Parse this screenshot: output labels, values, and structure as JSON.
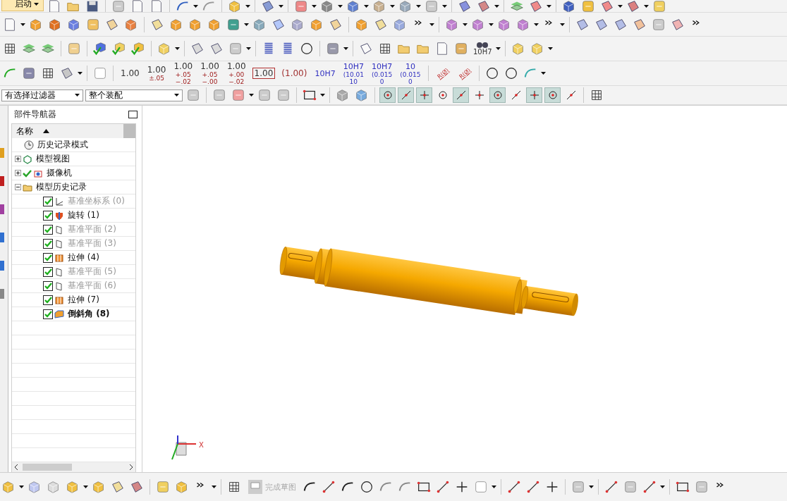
{
  "toolbar": {
    "start_button": "启动",
    "dimension_styles": [
      {
        "kind": "plain",
        "lines": [
          "1.00"
        ]
      },
      {
        "kind": "tol",
        "lines": [
          "1.00",
          "±.05"
        ]
      },
      {
        "kind": "tol",
        "lines": [
          "1.00",
          "+.05",
          "−.02"
        ]
      },
      {
        "kind": "tol",
        "lines": [
          "1.00",
          "+.05",
          "−.00"
        ]
      },
      {
        "kind": "tol",
        "lines": [
          "1.00",
          "+.00",
          "−.02"
        ]
      },
      {
        "kind": "boxed",
        "lines": [
          "1.00"
        ]
      },
      {
        "kind": "ref",
        "lines": [
          "(1.00)"
        ]
      },
      {
        "kind": "fit",
        "lines": [
          "10H7"
        ]
      },
      {
        "kind": "fit",
        "lines": [
          "10H7",
          "(10.01",
          "10"
        ]
      },
      {
        "kind": "fit",
        "lines": [
          "10H7",
          "(0.015",
          "0"
        ]
      },
      {
        "kind": "fit",
        "lines": [
          "10",
          "(0.015",
          "0"
        ]
      }
    ],
    "radius_labels": [
      "R(Ø)",
      "R(Ø)"
    ],
    "fit_query_label": "10H7"
  },
  "selection_bar": {
    "filter": "有选择过滤器",
    "scope": "整个装配",
    "snap_points": [
      {
        "selected": true
      },
      {
        "selected": true
      },
      {
        "selected": true
      },
      {
        "selected": false
      },
      {
        "selected": true
      },
      {
        "selected": false
      },
      {
        "selected": true
      },
      {
        "selected": false
      },
      {
        "selected": true
      },
      {
        "selected": true
      },
      {
        "selected": false
      }
    ]
  },
  "navigator": {
    "title": "部件导航器",
    "column": "名称",
    "items": [
      {
        "kind": "history-mode",
        "label": "历史记录模式",
        "checked": false
      },
      {
        "kind": "views",
        "label": "模型视图",
        "expanded": false,
        "checked": false
      },
      {
        "kind": "camera",
        "label": "摄像机",
        "expanded": false,
        "checked": true
      },
      {
        "kind": "history",
        "label": "模型历史记录",
        "expanded": true,
        "checked": false,
        "children": [
          {
            "kind": "csys",
            "label": "基准坐标系 (0)",
            "checked": true,
            "dimmed": true,
            "current": false
          },
          {
            "kind": "revolve",
            "label": "旋转 (1)",
            "checked": true,
            "dimmed": false,
            "current": false
          },
          {
            "kind": "plane",
            "label": "基准平面 (2)",
            "checked": true,
            "dimmed": true,
            "current": false
          },
          {
            "kind": "plane",
            "label": "基准平面 (3)",
            "checked": true,
            "dimmed": true,
            "current": false
          },
          {
            "kind": "extrude",
            "label": "拉伸 (4)",
            "checked": true,
            "dimmed": false,
            "current": false
          },
          {
            "kind": "plane",
            "label": "基准平面 (5)",
            "checked": true,
            "dimmed": true,
            "current": false
          },
          {
            "kind": "plane",
            "label": "基准平面 (6)",
            "checked": true,
            "dimmed": true,
            "current": false
          },
          {
            "kind": "extrude",
            "label": "拉伸 (7)",
            "checked": true,
            "dimmed": false,
            "current": false
          },
          {
            "kind": "chamfer",
            "label": "倒斜角 (8)",
            "checked": true,
            "dimmed": false,
            "current": true
          }
        ]
      }
    ]
  },
  "viewport": {
    "triad_label": "X"
  },
  "sketch_bar": {
    "finish_sketch": {
      "label": "完成草图",
      "disabled": true
    }
  }
}
